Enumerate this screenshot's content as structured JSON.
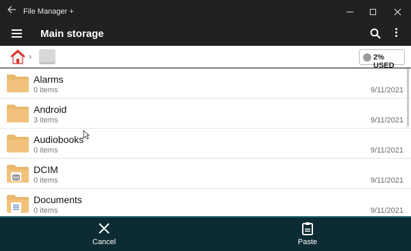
{
  "window": {
    "title": "File Manager +"
  },
  "appbar": {
    "title": "Main storage"
  },
  "breadcrumb": {
    "usage_label": "2% USED"
  },
  "files": [
    {
      "name": "Alarms",
      "count": "0 items",
      "date": "9/11/2021",
      "badge": "none"
    },
    {
      "name": "Android",
      "count": "3 items",
      "date": "9/11/2021",
      "badge": "none"
    },
    {
      "name": "Audiobooks",
      "count": "0 items",
      "date": "9/11/2021",
      "badge": "none"
    },
    {
      "name": "DCIM",
      "count": "0 items",
      "date": "9/11/2021",
      "badge": "camera-icon"
    },
    {
      "name": "Documents",
      "count": "0 items",
      "date": "9/11/2021",
      "badge": "document-icon"
    }
  ],
  "actions": {
    "cancel_label": "Cancel",
    "paste_label": "Paste"
  },
  "colors": {
    "folder": "#e8b86d",
    "action_bar": "#0d2b33",
    "home": "#d9342b"
  }
}
